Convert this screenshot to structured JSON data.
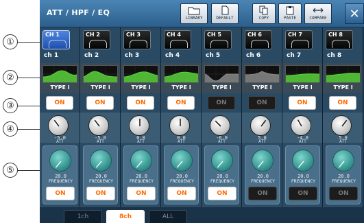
{
  "window": {
    "title": "ATT / HPF / EQ",
    "close_label": "✕"
  },
  "toolbar": {
    "library": "LIBRARY",
    "default": "DEFAULT",
    "copy": "COPY",
    "paste": "PASTE",
    "compare": "COMPARE"
  },
  "callouts": [
    "①",
    "②",
    "③",
    "④",
    "⑤"
  ],
  "channels": [
    {
      "button": "CH 1",
      "name": "ch 1",
      "selected": true,
      "eq_type": "TYPE I",
      "eq_on": "ON",
      "eq_state": "on",
      "att_value": "-5.0",
      "att_label": "ATT",
      "freq_value": "20.0",
      "freq_label": "FREQUENCY",
      "hpf_on": "ON",
      "hpf_state": "on"
    },
    {
      "button": "CH 2",
      "name": "ch 2",
      "selected": false,
      "eq_type": "TYPE I",
      "eq_on": "ON",
      "eq_state": "on",
      "att_value": "-5.0",
      "att_label": "ATT",
      "freq_value": "20.0",
      "freq_label": "FREQUENCY",
      "hpf_on": "ON",
      "hpf_state": "on"
    },
    {
      "button": "CH 3",
      "name": "ch 3",
      "selected": false,
      "eq_type": "TYPE I",
      "eq_on": "ON",
      "eq_state": "on",
      "att_value": "0.0",
      "att_label": "ATT",
      "freq_value": "20.0",
      "freq_label": "FREQUENCY",
      "hpf_on": "ON",
      "hpf_state": "on"
    },
    {
      "button": "CH 4",
      "name": "ch 4",
      "selected": false,
      "eq_type": "TYPE I",
      "eq_on": "ON",
      "eq_state": "on",
      "att_value": "0.0",
      "att_label": "ATT",
      "freq_value": "20.0",
      "freq_label": "FREQUENCY",
      "hpf_on": "ON",
      "hpf_state": "on"
    },
    {
      "button": "CH 5",
      "name": "ch 5",
      "selected": false,
      "eq_type": "TYPE I",
      "eq_on": "ON",
      "eq_state": "off",
      "att_value": "-6.0",
      "att_label": "ATT",
      "freq_value": "20.0",
      "freq_label": "FREQUENCY",
      "hpf_on": "ON",
      "hpf_state": "on"
    },
    {
      "button": "CH 6",
      "name": "ch 6",
      "selected": false,
      "eq_type": "TYPE I",
      "eq_on": "ON",
      "eq_state": "off",
      "att_value": "5.0",
      "att_label": "ATT",
      "freq_value": "20.0",
      "freq_label": "FREQUENCY",
      "hpf_on": "ON",
      "hpf_state": "off"
    },
    {
      "button": "CH 7",
      "name": "ch 7",
      "selected": false,
      "eq_type": "TYPE I",
      "eq_on": "ON",
      "eq_state": "on",
      "att_value": "-4.0",
      "att_label": "ATT",
      "freq_value": "20.0",
      "freq_label": "FREQUENCY",
      "hpf_on": "ON",
      "hpf_state": "off"
    },
    {
      "button": "CH 8",
      "name": "ch 8",
      "selected": false,
      "eq_type": "TYPE I",
      "eq_on": "ON",
      "eq_state": "on",
      "att_value": "5.0",
      "att_label": "ATT",
      "freq_value": "20.0",
      "freq_label": "FREQUENCY",
      "hpf_on": "ON",
      "hpf_state": "off"
    }
  ],
  "tabs": [
    {
      "label": "1ch",
      "active": false
    },
    {
      "label": "8ch",
      "active": true
    },
    {
      "label": "ALL",
      "active": false
    }
  ],
  "colors": {
    "on_text": "#ff6a00",
    "eq_curve": "#5bd23c",
    "eq_curve_off": "#8a8a8a",
    "freq_knob": "#2f8c88"
  }
}
